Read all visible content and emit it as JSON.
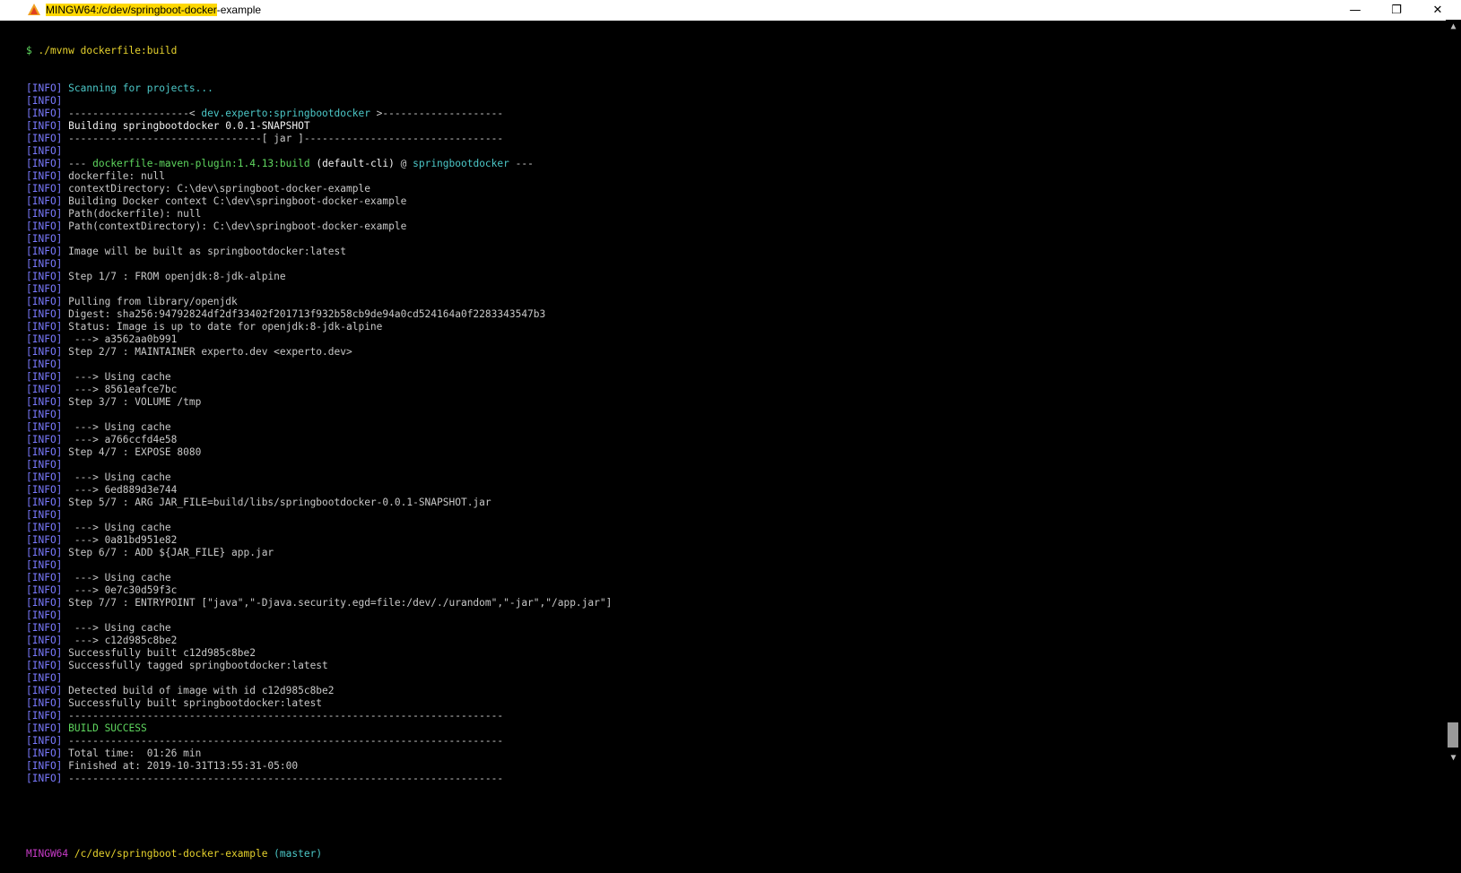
{
  "window": {
    "title_highlighted": "MINGW64:/c/dev/springboot-docker",
    "title_rest": "-example",
    "minimize_glyph": "—",
    "maximize_glyph": "❐",
    "close_glyph": "✕"
  },
  "terminal": {
    "prompt_symbol": "$",
    "command": " ./mvnw dockerfile:build",
    "tag": "[INFO]",
    "lines": [
      {
        "text": " Scanning for projects...",
        "color": "cyan"
      },
      {
        "text": "",
        "color": "default"
      },
      {
        "parts": [
          {
            "text": " --------------------< ",
            "color": "default"
          },
          {
            "text": "dev.experto:springbootdocker",
            "color": "cyan"
          },
          {
            "text": " >--------------------",
            "color": "default"
          }
        ]
      },
      {
        "text": " Building springbootdocker 0.0.1-SNAPSHOT",
        "color": "white"
      },
      {
        "text": " --------------------------------[ jar ]---------------------------------",
        "color": "default"
      },
      {
        "text": "",
        "color": "default"
      },
      {
        "parts": [
          {
            "text": " --- ",
            "color": "default"
          },
          {
            "text": "dockerfile-maven-plugin:1.4.13:build",
            "color": "green"
          },
          {
            "text": " (default-cli)",
            "color": "white"
          },
          {
            "text": " @ ",
            "color": "default"
          },
          {
            "text": "springbootdocker",
            "color": "cyan"
          },
          {
            "text": " ---",
            "color": "default"
          }
        ]
      },
      {
        "text": " dockerfile: null",
        "color": "default"
      },
      {
        "text": " contextDirectory: C:\\dev\\springboot-docker-example",
        "color": "default"
      },
      {
        "text": " Building Docker context C:\\dev\\springboot-docker-example",
        "color": "default"
      },
      {
        "text": " Path(dockerfile): null",
        "color": "default"
      },
      {
        "text": " Path(contextDirectory): C:\\dev\\springboot-docker-example",
        "color": "default"
      },
      {
        "text": "",
        "color": "default"
      },
      {
        "text": " Image will be built as springbootdocker:latest",
        "color": "default"
      },
      {
        "text": "",
        "color": "default"
      },
      {
        "text": " Step 1/7 : FROM openjdk:8-jdk-alpine",
        "color": "default"
      },
      {
        "text": "",
        "color": "default"
      },
      {
        "text": " Pulling from library/openjdk",
        "color": "default"
      },
      {
        "text": " Digest: sha256:94792824df2df33402f201713f932b58cb9de94a0cd524164a0f2283343547b3",
        "color": "default"
      },
      {
        "text": " Status: Image is up to date for openjdk:8-jdk-alpine",
        "color": "default"
      },
      {
        "text": "  ---> a3562aa0b991",
        "color": "default"
      },
      {
        "text": " Step 2/7 : MAINTAINER experto.dev <experto.dev>",
        "color": "default"
      },
      {
        "text": "",
        "color": "default"
      },
      {
        "text": "  ---> Using cache",
        "color": "default"
      },
      {
        "text": "  ---> 8561eafce7bc",
        "color": "default"
      },
      {
        "text": " Step 3/7 : VOLUME /tmp",
        "color": "default"
      },
      {
        "text": "",
        "color": "default"
      },
      {
        "text": "  ---> Using cache",
        "color": "default"
      },
      {
        "text": "  ---> a766ccfd4e58",
        "color": "default"
      },
      {
        "text": " Step 4/7 : EXPOSE 8080",
        "color": "default"
      },
      {
        "text": "",
        "color": "default"
      },
      {
        "text": "  ---> Using cache",
        "color": "default"
      },
      {
        "text": "  ---> 6ed889d3e744",
        "color": "default"
      },
      {
        "text": " Step 5/7 : ARG JAR_FILE=build/libs/springbootdocker-0.0.1-SNAPSHOT.jar",
        "color": "default"
      },
      {
        "text": "",
        "color": "default"
      },
      {
        "text": "  ---> Using cache",
        "color": "default"
      },
      {
        "text": "  ---> 0a81bd951e82",
        "color": "default"
      },
      {
        "text": " Step 6/7 : ADD ${JAR_FILE} app.jar",
        "color": "default"
      },
      {
        "text": "",
        "color": "default"
      },
      {
        "text": "  ---> Using cache",
        "color": "default"
      },
      {
        "text": "  ---> 0e7c30d59f3c",
        "color": "default"
      },
      {
        "text": " Step 7/7 : ENTRYPOINT [\"java\",\"-Djava.security.egd=file:/dev/./urandom\",\"-jar\",\"/app.jar\"]",
        "color": "default"
      },
      {
        "text": "",
        "color": "default"
      },
      {
        "text": "  ---> Using cache",
        "color": "default"
      },
      {
        "text": "  ---> c12d985c8be2",
        "color": "default"
      },
      {
        "text": " Successfully built c12d985c8be2",
        "color": "default"
      },
      {
        "text": " Successfully tagged springbootdocker:latest",
        "color": "default"
      },
      {
        "text": "",
        "color": "default"
      },
      {
        "text": " Detected build of image with id c12d985c8be2",
        "color": "default"
      },
      {
        "text": " Successfully built springbootdocker:latest",
        "color": "default"
      },
      {
        "text": " ------------------------------------------------------------------------",
        "color": "default"
      },
      {
        "text": " BUILD SUCCESS",
        "color": "green"
      },
      {
        "text": " ------------------------------------------------------------------------",
        "color": "default"
      },
      {
        "text": " Total time:  01:26 min",
        "color": "default"
      },
      {
        "text": " Finished at: 2019-10-31T13:55:31-05:00",
        "color": "default"
      },
      {
        "text": " ------------------------------------------------------------------------",
        "color": "default"
      }
    ],
    "prompt": {
      "host": "MINGW64",
      "path": " /c/dev/springboot-docker-example",
      "branch": " (master)"
    }
  },
  "scrollbar": {
    "up_glyph": "▲",
    "down_glyph": "▼"
  }
}
